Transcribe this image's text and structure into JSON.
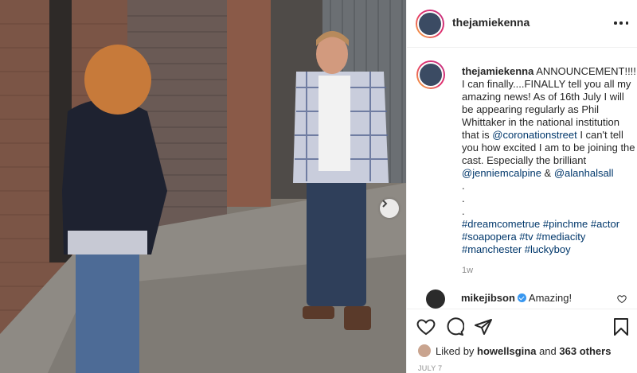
{
  "post": {
    "username": "thejamiekenna",
    "media_alt": "Coronation Street scene: two people talking in a cobbled alley",
    "caption": {
      "username": "thejamiekenna",
      "text_1": "ANNOUNCEMENT!!!! I can finally....FINALLY tell you all my amazing news! As of 16th July I will be appearing regularly as Phil Whittaker in the national institution that is ",
      "mention_1": "@coronationstreet",
      "text_2": " I can't tell you how excited I am to be joining the cast. Especially the brilliant ",
      "mention_2": "@jenniemcalpine",
      "text_3": " & ",
      "mention_3": "@alanhalsall",
      "dots": [
        ".",
        ".",
        "."
      ],
      "hashtags_line_1": [
        "#dreamcometrue",
        "#pinchme",
        "#actor"
      ],
      "hashtags_line_2": [
        "#soapopera",
        "#tv",
        "#mediacity"
      ],
      "hashtags_line_3": [
        "#manchester",
        "#luckyboy"
      ],
      "time": "1w"
    },
    "comment": {
      "username": "mikejibson",
      "text": "Amazing!"
    },
    "likes": {
      "prefix": "Liked by ",
      "user": "howellsgina",
      "middle": " and ",
      "count": "363 others"
    },
    "date": "JULY 7"
  },
  "icons": {
    "more": "more-options-icon",
    "like": "heart-icon",
    "comment": "comment-icon",
    "share": "share-icon",
    "save": "bookmark-icon",
    "next": "chevron-right-icon",
    "verified": "verified-badge-icon"
  },
  "colors": {
    "text": "#262626",
    "link": "#00376b",
    "muted": "#8e8e8e",
    "border": "#efefef",
    "verified": "#3897f0"
  }
}
